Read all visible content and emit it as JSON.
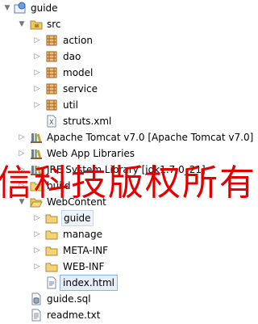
{
  "tree": {
    "project": "guide",
    "src": "src",
    "packages": [
      "action",
      "dao",
      "model",
      "service",
      "util"
    ],
    "struts": "struts.xml",
    "tomcat": "Apache Tomcat v7.0 [Apache Tomcat v7.0]",
    "webapp_libs": "Web App Libraries",
    "jre": "JRE System Library [jdk1.7.0_21]",
    "build": "build",
    "webcontent": "WebContent",
    "web_folders": [
      "guide",
      "manage",
      "META-INF",
      "WEB-INF"
    ],
    "index": "index.html",
    "guide_sql": "guide.sql",
    "readme": "readme.txt"
  },
  "watermark": "信科技版权所有"
}
